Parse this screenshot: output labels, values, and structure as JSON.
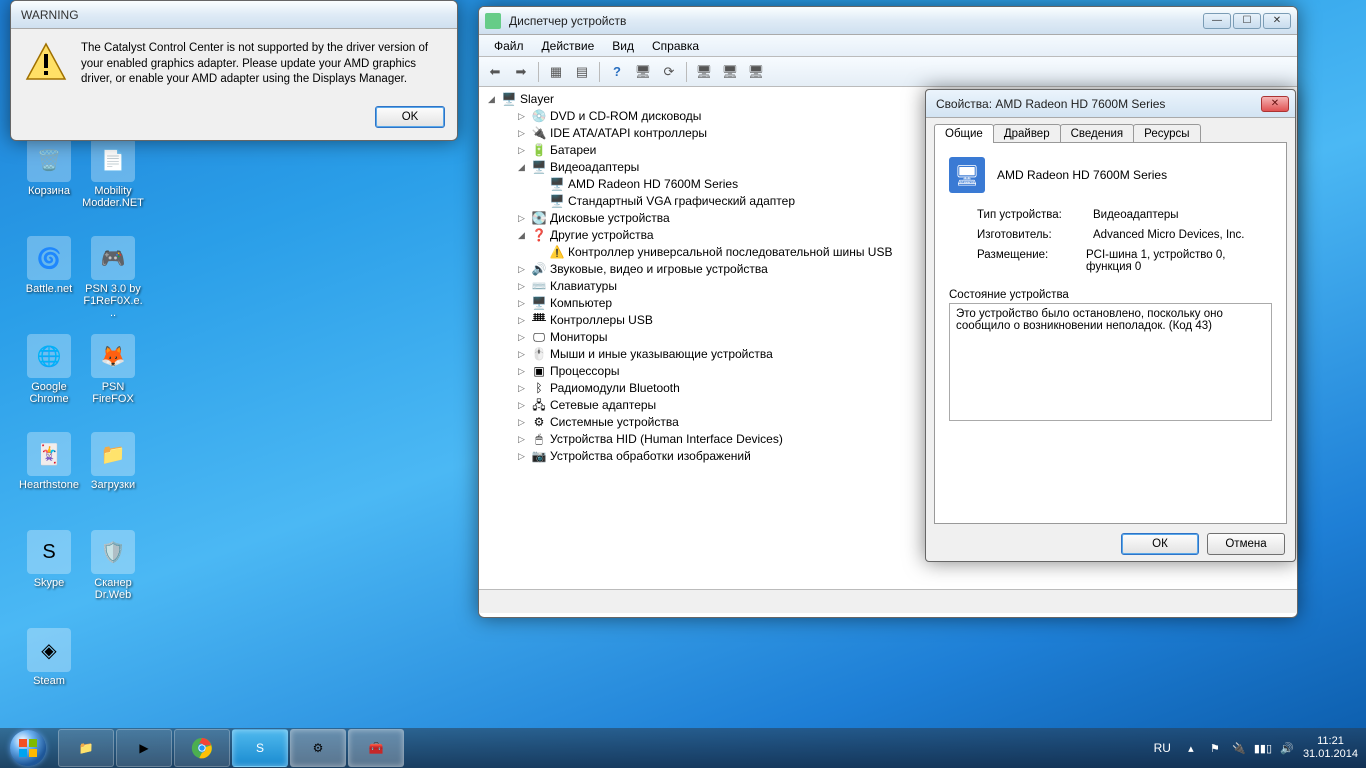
{
  "desktop": {
    "icons": [
      {
        "label": "Корзина"
      },
      {
        "label": "Mobility Modder.NET"
      },
      {
        "label": "Battle.net"
      },
      {
        "label": "PSN 3.0 by F1ReF0X.e..."
      },
      {
        "label": "Google Chrome"
      },
      {
        "label": "PSN FireFOX"
      },
      {
        "label": "Hearthstone"
      },
      {
        "label": "Загрузки"
      },
      {
        "label": "Skype"
      },
      {
        "label": "Сканер Dr.Web"
      },
      {
        "label": "Steam"
      }
    ]
  },
  "warning": {
    "title": "WARNING",
    "text": "The Catalyst Control Center is not supported by the driver version of your enabled graphics adapter. Please update your AMD graphics driver, or enable your AMD adapter using the Displays Manager.",
    "ok": "OK"
  },
  "devmgr": {
    "title": "Диспетчер устройств",
    "menu": {
      "file": "Файл",
      "action": "Действие",
      "view": "Вид",
      "help": "Справка"
    },
    "root": "Slayer",
    "nodes": [
      {
        "label": "DVD и CD-ROM дисководы",
        "icon": "disc",
        "d": 1
      },
      {
        "label": "IDE ATA/ATAPI контроллеры",
        "icon": "ide",
        "d": 1
      },
      {
        "label": "Батареи",
        "icon": "battery",
        "d": 1
      },
      {
        "label": "Видеоадаптеры",
        "icon": "display",
        "d": 1,
        "open": true
      },
      {
        "label": "AMD Radeon HD 7600M Series",
        "icon": "display",
        "d": 2,
        "leaf": true
      },
      {
        "label": "Стандартный VGA графический адаптер",
        "icon": "display",
        "d": 2,
        "leaf": true
      },
      {
        "label": "Дисковые устройства",
        "icon": "hdd",
        "d": 1
      },
      {
        "label": "Другие устройства",
        "icon": "other",
        "d": 1,
        "open": true
      },
      {
        "label": "Контроллер универсальной последовательной шины USB",
        "icon": "warn",
        "d": 2,
        "leaf": true
      },
      {
        "label": "Звуковые, видео и игровые устройства",
        "icon": "sound",
        "d": 1
      },
      {
        "label": "Клавиатуры",
        "icon": "keyboard",
        "d": 1
      },
      {
        "label": "Компьютер",
        "icon": "computer",
        "d": 1
      },
      {
        "label": "Контроллеры USB",
        "icon": "usb",
        "d": 1
      },
      {
        "label": "Мониторы",
        "icon": "monitor",
        "d": 1
      },
      {
        "label": "Мыши и иные указывающие устройства",
        "icon": "mouse",
        "d": 1
      },
      {
        "label": "Процессоры",
        "icon": "cpu",
        "d": 1
      },
      {
        "label": "Радиомодули Bluetooth",
        "icon": "bt",
        "d": 1
      },
      {
        "label": "Сетевые адаптеры",
        "icon": "net",
        "d": 1
      },
      {
        "label": "Системные устройства",
        "icon": "sys",
        "d": 1
      },
      {
        "label": "Устройства HID (Human Interface Devices)",
        "icon": "hid",
        "d": 1
      },
      {
        "label": "Устройства обработки изображений",
        "icon": "imaging",
        "d": 1
      }
    ]
  },
  "props": {
    "title": "Свойства: AMD Radeon HD 7600M Series",
    "tabs": {
      "general": "Общие",
      "driver": "Драйвер",
      "details": "Сведения",
      "resources": "Ресурсы"
    },
    "device_name": "AMD Radeon HD 7600M Series",
    "rows": {
      "type_label": "Тип устройства:",
      "type_value": "Видеоадаптеры",
      "mfg_label": "Изготовитель:",
      "mfg_value": "Advanced Micro Devices, Inc.",
      "loc_label": "Размещение:",
      "loc_value": "PCI-шина 1, устройство 0, функция 0"
    },
    "status_label": "Состояние устройства",
    "status_text": "Это устройство было остановлено, поскольку оно сообщило о возникновении неполадок. (Код 43)",
    "ok": "ОК",
    "cancel": "Отмена"
  },
  "taskbar": {
    "lang": "RU",
    "time": "11:21",
    "date": "31.01.2014"
  }
}
